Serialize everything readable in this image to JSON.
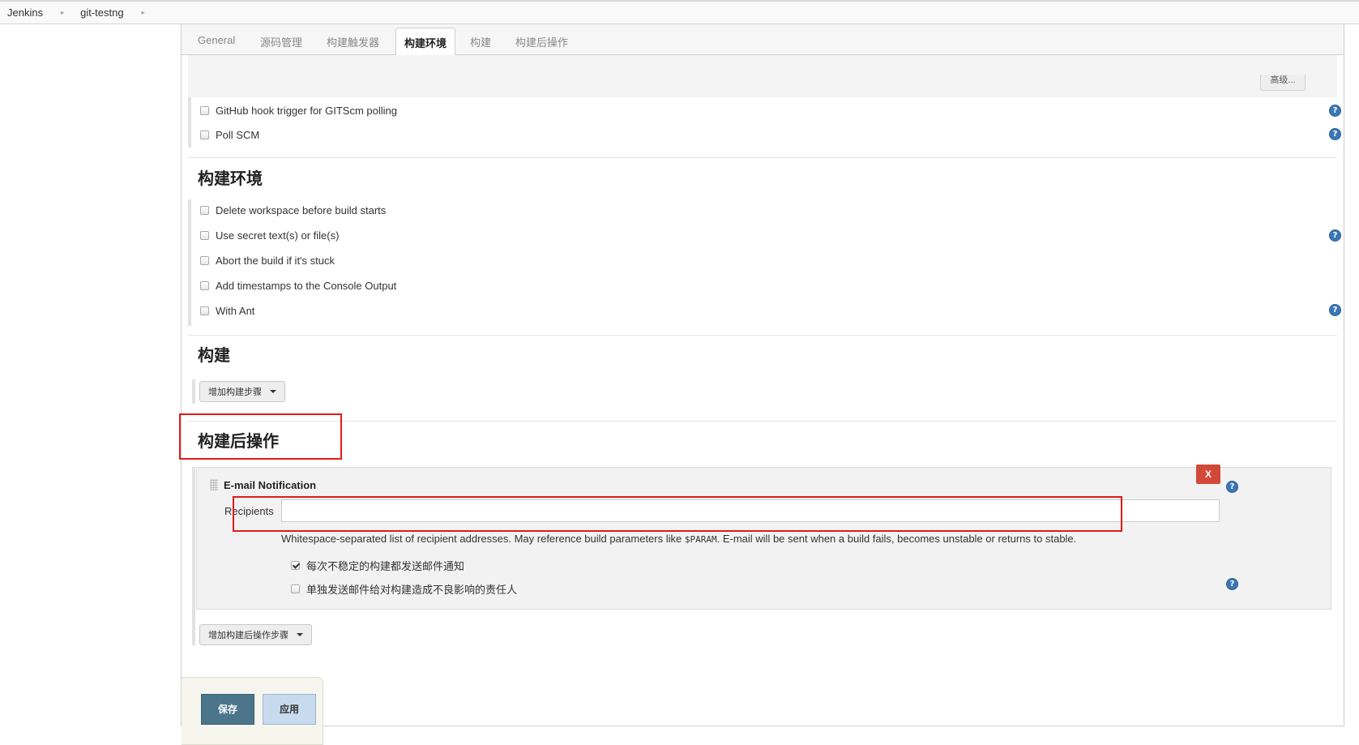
{
  "breadcrumb": {
    "items": [
      "Jenkins",
      "git-testng"
    ],
    "separator": "▸"
  },
  "tabs": [
    "General",
    "源码管理",
    "构建触发器",
    "构建环境",
    "构建",
    "构建后操作"
  ],
  "active_tab": "构建环境",
  "advanced_button": "高级...",
  "triggers": {
    "items": [
      "GitHub hook trigger for GITScm polling",
      "Poll SCM"
    ]
  },
  "build_env": {
    "title": "构建环境",
    "items": [
      "Delete workspace before build starts",
      "Use secret text(s) or file(s)",
      "Abort the build if it's stuck",
      "Add timestamps to the Console Output",
      "With Ant"
    ]
  },
  "build": {
    "title": "构建",
    "add_step_button": "增加构建步骤"
  },
  "post_build": {
    "title": "构建后操作",
    "email": {
      "title": "E-mail Notification",
      "delete_label": "X",
      "recipients_label": "Recipients",
      "recipients_value": "",
      "description_pre": "Whitespace-separated list of recipient addresses. May reference build parameters like ",
      "description_code": "$PARAM",
      "description_post": ". E-mail will be sent when a build fails, becomes unstable or returns to stable.",
      "option_unstable": "每次不稳定的构建都发送邮件通知",
      "option_unstable_checked": true,
      "option_individual": "单独发送邮件给对构建造成不良影响的责任人",
      "option_individual_checked": false
    },
    "add_step_button": "增加构建后操作步骤"
  },
  "buttons": {
    "save": "保存",
    "apply": "应用"
  },
  "help_glyph": "?",
  "colors": {
    "highlight": "#e21a1a",
    "save_button": "#4b758b",
    "apply_button": "#c8dbee",
    "delete_button": "#d24939",
    "help_icon": "#3a77b5"
  }
}
